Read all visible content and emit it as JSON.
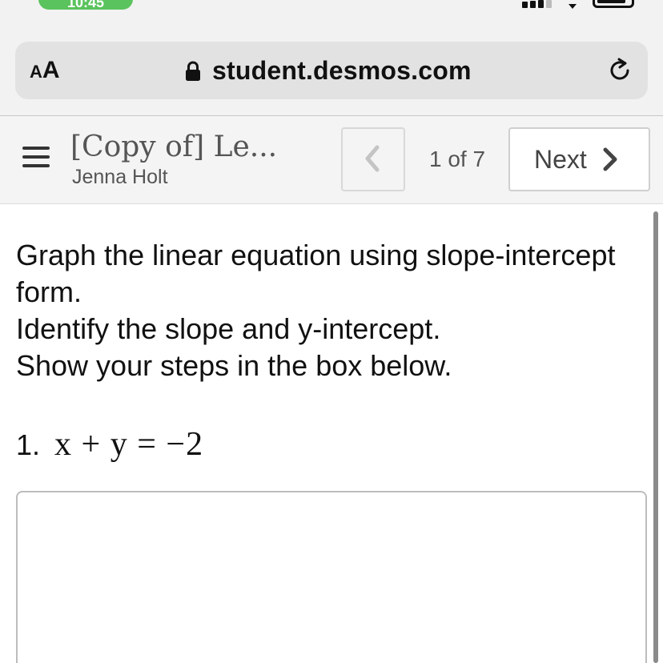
{
  "status_bar": {
    "time": "10:45",
    "time_pill_color": "#5ac35d"
  },
  "browser": {
    "text_size_small": "A",
    "text_size_big": "A",
    "url": "student.desmos.com",
    "icons": [
      "lock-icon",
      "reload-icon"
    ]
  },
  "header": {
    "menu_icon": "hamburger-menu-icon",
    "activity_title": "[Copy of] Le...",
    "teacher_name": "Jenna Holt",
    "page_indicator": "1 of 7",
    "next_label": "Next",
    "prev_icon": "chevron-left-icon",
    "next_icon": "chevron-right-icon"
  },
  "content": {
    "prompt_lines": [
      "Graph the linear equation using slope-intercept form.",
      "Identify the slope and y-intercept.",
      "Show your steps in the box below."
    ],
    "question_number": "1.",
    "question_equation": "x + y = −2",
    "answer_value": ""
  }
}
